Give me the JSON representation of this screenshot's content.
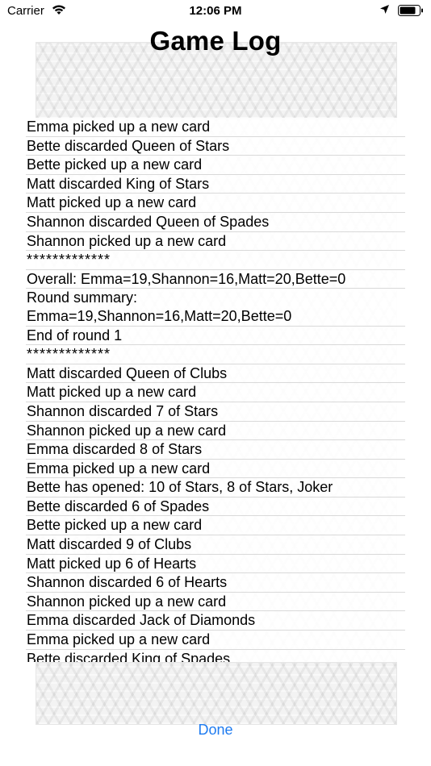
{
  "status_bar": {
    "carrier": "Carrier",
    "time": "12:06 PM"
  },
  "title": "Game Log",
  "log": [
    "Emma picked up a new card",
    "Bette discarded Queen of Stars",
    "Bette picked up a new card",
    "Matt discarded King of Stars",
    "Matt picked up a new card",
    "Shannon discarded Queen of Spades",
    "Shannon picked up a new card",
    "*************",
    "Overall: Emma=19,Shannon=16,Matt=20,Bette=0",
    "Round summary:\nEmma=19,Shannon=16,Matt=20,Bette=0",
    "End of round 1",
    "*************",
    "Matt discarded Queen of Clubs",
    "Matt picked up a new card",
    "Shannon discarded 7 of Stars",
    "Shannon picked up a new card",
    "Emma discarded 8 of Stars",
    "Emma picked up a new card",
    "Bette has opened: 10 of Stars, 8 of Stars, Joker",
    "Bette discarded 6 of Spades",
    "Bette picked up a new card",
    "Matt discarded 9 of Clubs",
    "Matt picked up 6 of Hearts",
    "Shannon discarded 6 of Hearts",
    "Shannon picked up a new card",
    "Emma discarded Jack of Diamonds",
    "Emma picked up a new card",
    "Bette discarded King of Spades"
  ],
  "done_label": "Done"
}
